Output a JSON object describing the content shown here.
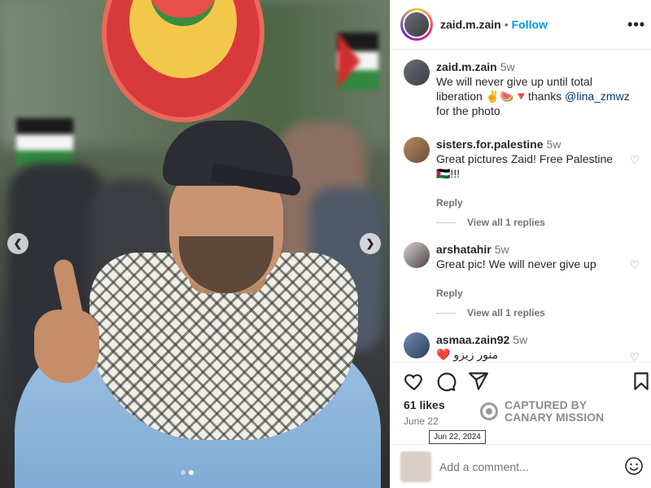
{
  "post": {
    "author": "zaid.m.zain",
    "separator": "•",
    "follow_label": "Follow",
    "more_icon": "more-horizontal-icon",
    "caption": {
      "user": "zaid.m.zain",
      "time": "5w",
      "text_before": "We will never give up until total liberation ✌️🍉🔻thanks ",
      "mention": "@lina_zmwz",
      "text_after": " for the photo"
    },
    "likes": "61 likes",
    "date": "June 22",
    "date_tooltip": "Jun 22, 2024"
  },
  "comments": [
    {
      "user": "sisters.for.palestine",
      "time": "5w",
      "text": "Great pictures Zaid! Free Palestine 🇵🇸!!!",
      "reply": "Reply",
      "view_replies": "View all 1 replies"
    },
    {
      "user": "arshatahir",
      "time": "5w",
      "text": "Great pic! We will never give up",
      "reply": "Reply",
      "view_replies": "View all 1 replies"
    },
    {
      "user": "asmaa.zain92",
      "time": "5w",
      "text": "❤️ منور زيزو"
    }
  ],
  "add_comment": {
    "placeholder": "Add a comment..."
  },
  "watermark": {
    "line1": "CAPTURED BY",
    "line2": "CANARY MISSION"
  },
  "carousel": {
    "prev_icon": "chevron-left-icon",
    "next_icon": "chevron-right-icon",
    "slides": 2,
    "active": 1
  },
  "colors": {
    "link": "#0095f6",
    "mention": "#00376b",
    "muted": "#737373"
  }
}
